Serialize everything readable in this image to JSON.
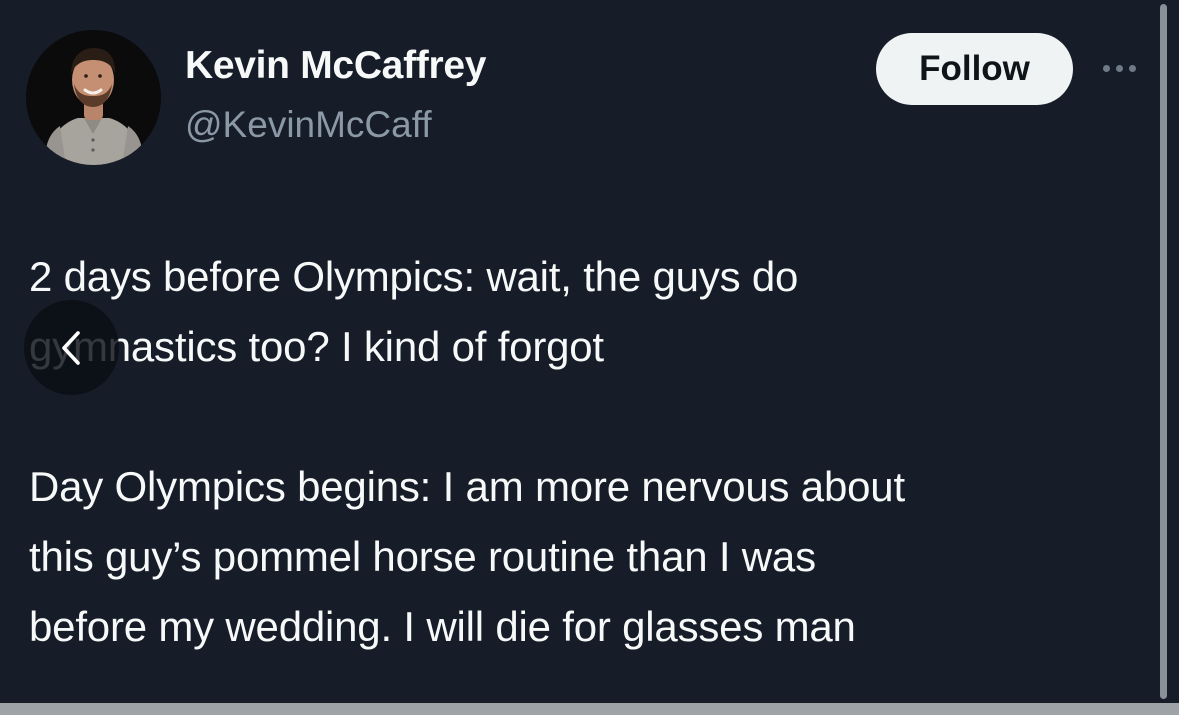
{
  "tweet": {
    "author": {
      "display_name": "Kevin McCaffrey",
      "handle": "@KevinMcCaff",
      "avatar": "profile-photo"
    },
    "follow_label": "Follow",
    "more_icon": "more-horizontal-icon",
    "text": {
      "line1": "2 days before Olympics: wait, the guys do",
      "line2": "gymnastics too? I kind of forgot",
      "line3": "Day Olympics begins: I am more nervous about",
      "line4": "this guy’s pommel horse routine than I was",
      "line5": "before my wedding. I will die for glasses man"
    }
  },
  "overlay": {
    "back_icon": "chevron-left-icon"
  },
  "colors": {
    "background": "#161d29",
    "text": "#f7f9f9",
    "secondary_text": "#8b98a5",
    "follow_button_bg": "#eff3f4",
    "follow_button_text": "#0f1419"
  }
}
